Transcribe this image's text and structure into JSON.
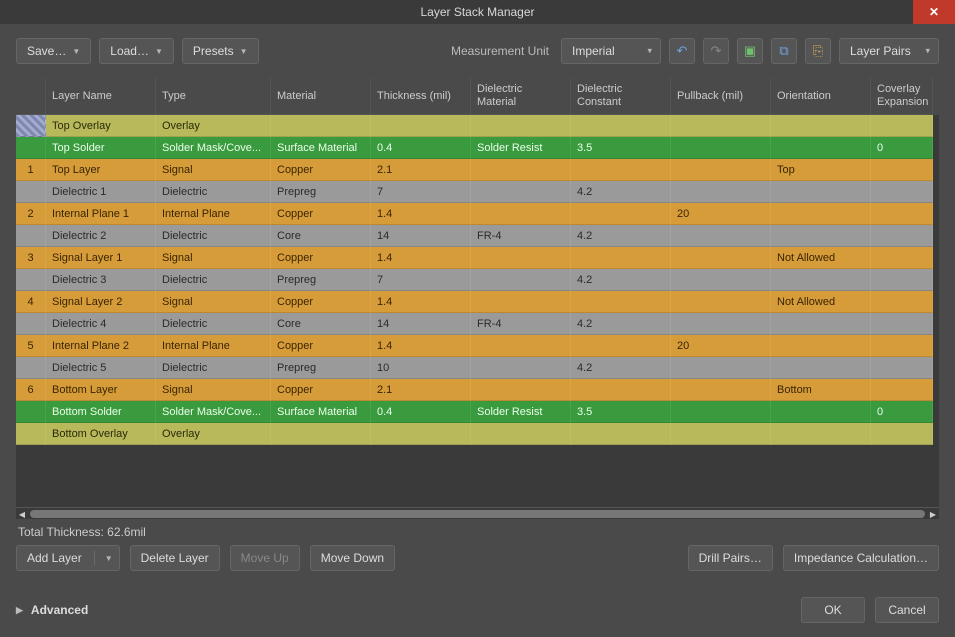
{
  "window": {
    "title": "Layer Stack Manager"
  },
  "toolbar": {
    "save": "Save…",
    "load": "Load…",
    "presets": "Presets",
    "measurement_label": "Measurement Unit",
    "measurement_unit": "Imperial",
    "mode": "Layer Pairs"
  },
  "columns": [
    "",
    "Layer Name",
    "Type",
    "Material",
    "Thickness (mil)",
    "Dielectric Material",
    "Dielectric Constant",
    "Pullback (mil)",
    "Orientation",
    "Coverlay Expansion"
  ],
  "rows": [
    {
      "color": "olive",
      "idx": "",
      "name": "Top Overlay",
      "type": "Overlay",
      "material": "",
      "thickness": "",
      "dmat": "",
      "dconst": "",
      "pullback": "",
      "orient": "",
      "cov": "",
      "first": true
    },
    {
      "color": "green",
      "idx": "",
      "name": "Top Solder",
      "type": "Solder Mask/Cove...",
      "material": "Surface Material",
      "thickness": "0.4",
      "dmat": "Solder Resist",
      "dconst": "3.5",
      "pullback": "",
      "orient": "",
      "cov": "0"
    },
    {
      "color": "orange",
      "idx": "1",
      "name": "Top Layer",
      "type": "Signal",
      "material": "Copper",
      "thickness": "2.1",
      "dmat": "",
      "dconst": "",
      "pullback": "",
      "orient": "Top",
      "cov": ""
    },
    {
      "color": "gray",
      "idx": "",
      "name": "Dielectric 1",
      "type": "Dielectric",
      "material": "Prepreg",
      "thickness": "7",
      "dmat": "",
      "dconst": "4.2",
      "pullback": "",
      "orient": "",
      "cov": ""
    },
    {
      "color": "orange",
      "idx": "2",
      "name": "Internal Plane 1",
      "type": "Internal Plane",
      "material": "Copper",
      "thickness": "1.4",
      "dmat": "",
      "dconst": "",
      "pullback": "20",
      "orient": "",
      "cov": ""
    },
    {
      "color": "gray",
      "idx": "",
      "name": "Dielectric 2",
      "type": "Dielectric",
      "material": "Core",
      "thickness": "14",
      "dmat": "FR-4",
      "dconst": "4.2",
      "pullback": "",
      "orient": "",
      "cov": ""
    },
    {
      "color": "orange",
      "idx": "3",
      "name": "Signal Layer 1",
      "type": "Signal",
      "material": "Copper",
      "thickness": "1.4",
      "dmat": "",
      "dconst": "",
      "pullback": "",
      "orient": "Not Allowed",
      "cov": ""
    },
    {
      "color": "gray",
      "idx": "",
      "name": "Dielectric 3",
      "type": "Dielectric",
      "material": "Prepreg",
      "thickness": "7",
      "dmat": "",
      "dconst": "4.2",
      "pullback": "",
      "orient": "",
      "cov": ""
    },
    {
      "color": "orange",
      "idx": "4",
      "name": "Signal Layer 2",
      "type": "Signal",
      "material": "Copper",
      "thickness": "1.4",
      "dmat": "",
      "dconst": "",
      "pullback": "",
      "orient": "Not Allowed",
      "cov": ""
    },
    {
      "color": "gray",
      "idx": "",
      "name": "Dielectric 4",
      "type": "Dielectric",
      "material": "Core",
      "thickness": "14",
      "dmat": "FR-4",
      "dconst": "4.2",
      "pullback": "",
      "orient": "",
      "cov": ""
    },
    {
      "color": "orange",
      "idx": "5",
      "name": "Internal Plane 2",
      "type": "Internal Plane",
      "material": "Copper",
      "thickness": "1.4",
      "dmat": "",
      "dconst": "",
      "pullback": "20",
      "orient": "",
      "cov": ""
    },
    {
      "color": "gray",
      "idx": "",
      "name": "Dielectric 5",
      "type": "Dielectric",
      "material": "Prepreg",
      "thickness": "10",
      "dmat": "",
      "dconst": "4.2",
      "pullback": "",
      "orient": "",
      "cov": ""
    },
    {
      "color": "orange",
      "idx": "6",
      "name": "Bottom Layer",
      "type": "Signal",
      "material": "Copper",
      "thickness": "2.1",
      "dmat": "",
      "dconst": "",
      "pullback": "",
      "orient": "Bottom",
      "cov": ""
    },
    {
      "color": "green",
      "idx": "",
      "name": "Bottom Solder",
      "type": "Solder Mask/Cove...",
      "material": "Surface Material",
      "thickness": "0.4",
      "dmat": "Solder Resist",
      "dconst": "3.5",
      "pullback": "",
      "orient": "",
      "cov": "0"
    },
    {
      "color": "olive",
      "idx": "",
      "name": "Bottom Overlay",
      "type": "Overlay",
      "material": "",
      "thickness": "",
      "dmat": "",
      "dconst": "",
      "pullback": "",
      "orient": "",
      "cov": ""
    }
  ],
  "status": {
    "total_thickness": "Total Thickness: 62.6mil"
  },
  "buttons": {
    "add_layer": "Add Layer",
    "delete_layer": "Delete Layer",
    "move_up": "Move Up",
    "move_down": "Move Down",
    "drill_pairs": "Drill Pairs…",
    "impedance": "Impedance Calculation…",
    "ok": "OK",
    "cancel": "Cancel",
    "advanced": "Advanced"
  }
}
